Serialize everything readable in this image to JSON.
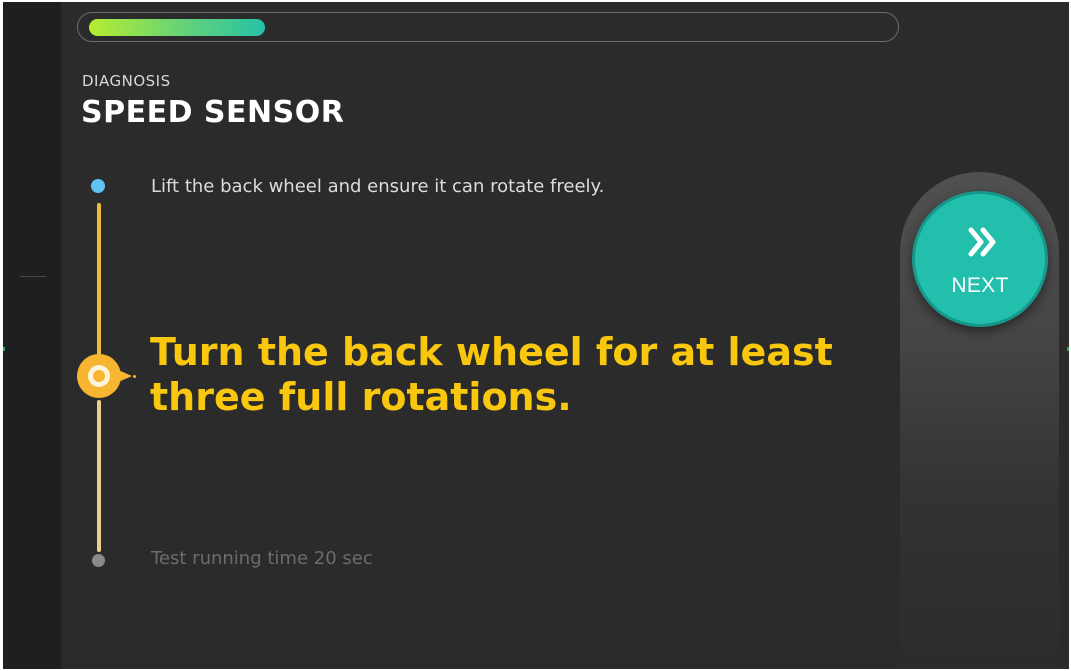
{
  "progress": {
    "fraction": 0.22,
    "colors": [
      "#b6ec30",
      "#25c2a6"
    ]
  },
  "header": {
    "kicker": "DIAGNOSIS",
    "title": "SPEED SENSOR"
  },
  "steps": [
    {
      "status": "done",
      "text": "Lift the back wheel and ensure it can rotate freely."
    },
    {
      "status": "active",
      "text": "Turn the back wheel for at least three full rotations."
    },
    {
      "status": "pending",
      "text": "Test running time 20 sec"
    }
  ],
  "next_button": {
    "label": "NEXT",
    "icon": "double-chevron-right-icon",
    "color": "#22bfad"
  },
  "colors": {
    "accent_active": "#f9c80e",
    "done_dot": "#5ec2f2",
    "background": "#2b2b2b"
  }
}
